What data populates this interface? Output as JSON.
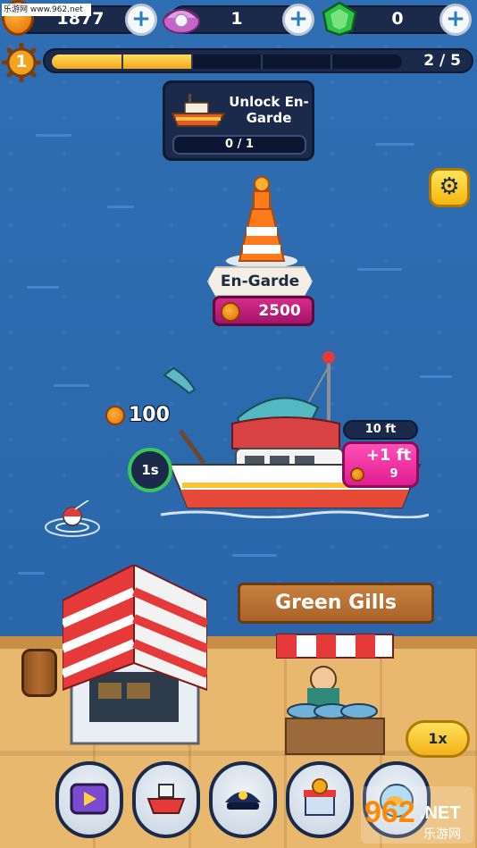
{
  "top_bar": {
    "coins": "1877",
    "pearls": "1",
    "gems": "0",
    "plus_label": "+"
  },
  "level": {
    "number": "1",
    "progress_text": "2 / 5",
    "progress_fraction": 0.4
  },
  "unlock": {
    "title": "Unlock En-Garde",
    "progress": "0 / 1"
  },
  "destination": {
    "name": "En-Garde",
    "price": "2500"
  },
  "boat": {
    "catch_amount": "100",
    "timer": "1s",
    "depth": "10 ft",
    "upgrade_label": "+1 ft",
    "upgrade_cost": "9"
  },
  "shop": {
    "name": "Green Gills"
  },
  "speed": {
    "label": "1x"
  },
  "nav": {
    "items": [
      "tv-ads",
      "boats",
      "captain",
      "shop",
      "fish"
    ]
  },
  "watermark": {
    "top_text": "乐游网 www.962.net",
    "logo_main": "962",
    "logo_net": ".NET",
    "logo_sub": "乐游网"
  },
  "colors": {
    "sea": "#2f6eb2",
    "dock": "#e8b86f",
    "hud": "#1b2a4a",
    "accent_pink": "#e01d8f",
    "accent_yellow": "#f3b21a"
  }
}
